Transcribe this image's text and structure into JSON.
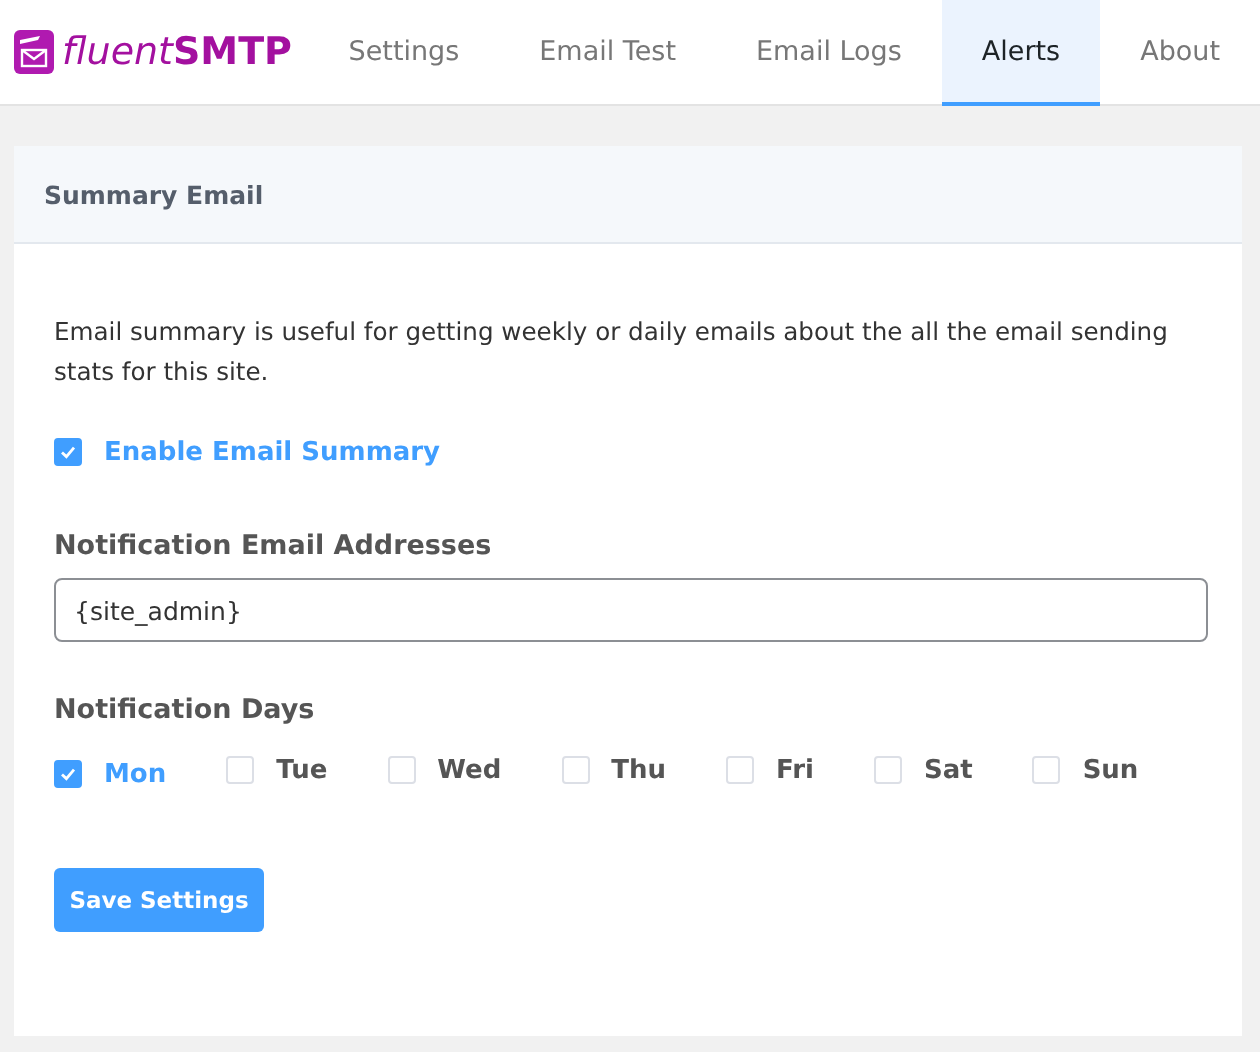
{
  "logo": {
    "prefix": "fluent",
    "suffix": "SMTP"
  },
  "tabs": [
    {
      "label": "Settings",
      "selected": false
    },
    {
      "label": "Email Test",
      "selected": false
    },
    {
      "label": "Email Logs",
      "selected": false
    },
    {
      "label": "Alerts",
      "selected": true
    },
    {
      "label": "About",
      "selected": false
    }
  ],
  "card": {
    "title": "Summary Email",
    "description": "Email summary is useful for getting weekly or daily emails about the all the email sending stats for this site.",
    "enable": {
      "label": "Enable Email Summary",
      "checked": true
    },
    "addresses": {
      "label": "Notification Email Addresses",
      "value": "{site_admin}"
    },
    "days": {
      "label": "Notification Days",
      "items": [
        {
          "label": "Mon",
          "checked": true
        },
        {
          "label": "Tue",
          "checked": false
        },
        {
          "label": "Wed",
          "checked": false
        },
        {
          "label": "Thu",
          "checked": false
        },
        {
          "label": "Fri",
          "checked": false
        },
        {
          "label": "Sat",
          "checked": false
        },
        {
          "label": "Sun",
          "checked": false
        }
      ]
    },
    "save_button": "Save Settings"
  }
}
